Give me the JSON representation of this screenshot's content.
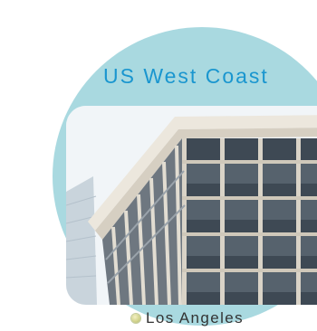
{
  "header": {
    "title": "US West Coast"
  },
  "photo": {
    "subject": "office-building-photo"
  },
  "caption": {
    "label": "Los Angeles",
    "bullet_icon": "circle-bullet-icon"
  },
  "colors": {
    "circle_bg": "#a9d9e0",
    "title": "#1a96cf",
    "caption_text": "#333333"
  }
}
